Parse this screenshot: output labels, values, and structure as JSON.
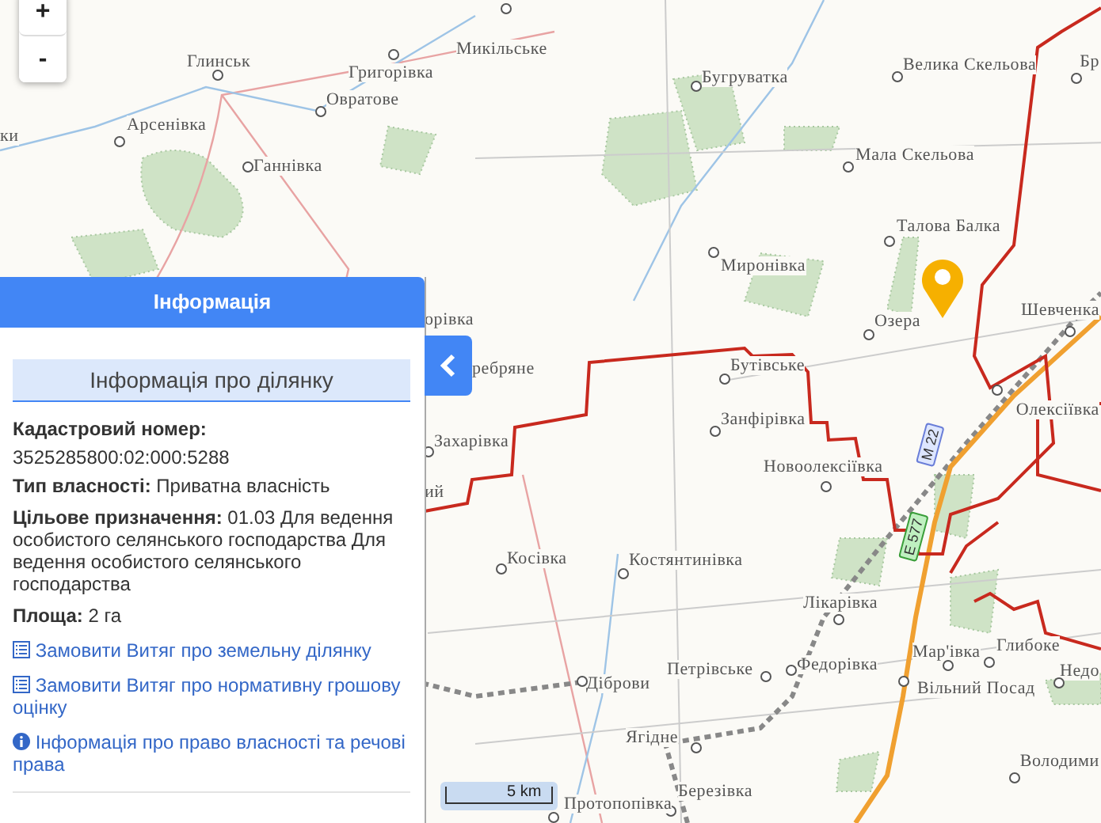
{
  "map": {
    "zoom_buttons": [
      "+",
      "-"
    ],
    "places": [
      {
        "name": "Глинськ"
      },
      {
        "name": "Григорівка"
      },
      {
        "name": "Микільське"
      },
      {
        "name": "Овратове"
      },
      {
        "name": "Арсенівка"
      },
      {
        "name": "Ганнівка"
      },
      {
        "name": "ки"
      },
      {
        "name": "Бугруватка"
      },
      {
        "name": "Велика Скельова"
      },
      {
        "name": "Бр"
      },
      {
        "name": "Мала Скельова"
      },
      {
        "name": "Талова Балка"
      },
      {
        "name": "Миронівка"
      },
      {
        "name": "орівка"
      },
      {
        "name": "Озера"
      },
      {
        "name": "Шевченка"
      },
      {
        "name": "ребряне"
      },
      {
        "name": "Бутівське"
      },
      {
        "name": "Олексіївка"
      },
      {
        "name": "Захарівка"
      },
      {
        "name": "Занфірівка"
      },
      {
        "name": "Новоолексіївка"
      },
      {
        "name": "ий"
      },
      {
        "name": "Косівка"
      },
      {
        "name": "Костянтинівка"
      },
      {
        "name": "Лікарівка"
      },
      {
        "name": "Петрівське"
      },
      {
        "name": "Федорівка"
      },
      {
        "name": "Мар'івка"
      },
      {
        "name": "Глибоке"
      },
      {
        "name": "Вільний Посад"
      },
      {
        "name": "Недо"
      },
      {
        "name": "Діброви"
      },
      {
        "name": "Ягідне"
      },
      {
        "name": "Володими"
      },
      {
        "name": "Березівка"
      },
      {
        "name": "Протопопівка"
      }
    ],
    "road_signs": [
      {
        "text": "М 22",
        "kind": "national"
      },
      {
        "text": "Е 577",
        "kind": "european"
      }
    ],
    "scale": "5 km"
  },
  "panel": {
    "title": "Інформація",
    "section_title": "Інформація про ділянку",
    "fields": [
      {
        "kind": "stacked",
        "label": "Кадастровий номер:",
        "value": "3525285800:02:000:5288"
      },
      {
        "kind": "inline",
        "text": "**Тип власності:** Приватна власність"
      },
      {
        "kind": "inline",
        "text": "**Цільове призначення:** 01.03 Для ведення особистого селянського господарства Для ведення особистого селянського господарства"
      },
      {
        "kind": "inline",
        "text": "**Площа:** 2 га"
      }
    ],
    "links": [
      {
        "kind": "document",
        "text": "Замовити Витяг про земельну ділянку"
      },
      {
        "kind": "document",
        "text": "Замовити Витяг про нормативну грошову оцінку"
      },
      {
        "kind": "info",
        "text": "Інформація про право власності та речові права"
      }
    ]
  }
}
